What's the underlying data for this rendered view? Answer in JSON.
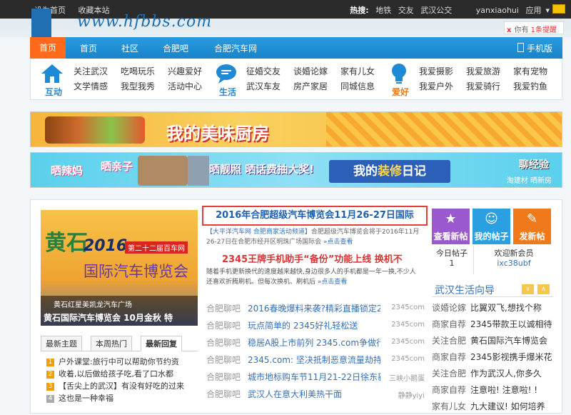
{
  "topbar": {
    "left": [
      "设为首页",
      "收藏本站"
    ],
    "hot_label": "热搜:",
    "hot": [
      "地铁",
      "交友",
      "武汉公交"
    ],
    "username": "yanxiaohui",
    "apps": "应用"
  },
  "site": {
    "url": "www.hfbbs.com"
  },
  "notify": {
    "close": "x",
    "text": "你有",
    "link": "1条提醒"
  },
  "nav": {
    "items": [
      "首页",
      "首页",
      "社区",
      "合肥吧",
      "合肥汽车网"
    ],
    "mobile": "手机版"
  },
  "subnav": {
    "groups": [
      {
        "label": "互动",
        "icon": "house-icon",
        "col1": [
          "关注武汉",
          "文学情感"
        ],
        "col2": [
          "吃喝玩乐",
          "我型我秀"
        ],
        "col3": [
          "兴趣爱好",
          "活动中心"
        ]
      },
      {
        "label": "生活",
        "icon": "chat-icon",
        "col1": [
          "征婚交友",
          "武汉车友"
        ],
        "col2": [
          "谈婚论嫁",
          "房产家居"
        ],
        "col3": [
          "家有儿女",
          "同城信息"
        ]
      },
      {
        "label": "爱好",
        "icon": "lightbulb-icon",
        "col1": [
          "我爱摄影",
          "我爱户外"
        ],
        "col2": [
          "我爱旅游",
          "我爱骑行"
        ],
        "col3": [
          "家有宠物",
          "我爱钓鱼"
        ]
      }
    ]
  },
  "banners": {
    "kitchen": {
      "title": "我的美味厨房"
    },
    "deco": {
      "a": "晒辣妈",
      "b": "晒亲子",
      "c": "晒靓照 晒话费抽大奖!",
      "d_prefix": "我的",
      "d_em": "装修",
      "d_suffix": "日记",
      "e": "聊经验",
      "f": "淘建材 晒新房"
    }
  },
  "slide": {
    "big": "黄石",
    "year": "2016",
    "tag": "第二十二届百车网",
    "expo": "国际汽车博览会",
    "small": "黄石红星美凯龙汽车广场",
    "caption": "黄石国际汽车博览会 10月金秋 特"
  },
  "tabs": [
    "最新主题",
    "本周热门",
    "最新回复"
  ],
  "hot": [
    {
      "n": "1",
      "text": "户外课堂:旅行中可以帮助你节约资"
    },
    {
      "n": "2",
      "text": "收着,以后做给孩子吃,看了口水都"
    },
    {
      "n": "3",
      "text": "【舌尖上的武汉】有没有好吃的过来"
    },
    {
      "n": "4",
      "text": "这也是一种幸福"
    }
  ],
  "headline": "2016年合肥超级汽车博览会11月26-27日国际",
  "news1": {
    "pre": "【大平洋汽车网 合肥商家活动频道】",
    "body": "合肥超级汽车博览会将于2016年11月26-27日在合肥市经开区明珠广场国际会",
    "more": "»点击查看"
  },
  "h2": "2345王牌手机助手“备份”功能上线 换机不",
  "news2": {
    "body": "随着手机更新换代的速度越来越快,身边很多人的手机都是一年一换,不少人还喜欢折腾刷机。但每次换机、刷机后",
    "more": "»点击查看"
  },
  "list": [
    {
      "cat": "合肥聊吧",
      "txt": "2016春晚爆料来袭?精彩直播锁定2345",
      "src": "2345com"
    },
    {
      "cat": "合肥聊吧",
      "txt": "玩点简单的 2345好礼轻松送",
      "src": "2345com"
    },
    {
      "cat": "合肥聊吧",
      "txt": "稳居A股上市前列 2345.com争做行业",
      "src": "2345com"
    },
    {
      "cat": "合肥聊吧",
      "txt": "2345.com: 坚决抵制恶意流量劫持",
      "src": "2345com"
    },
    {
      "cat": "合肥聊吧",
      "txt": "城市地标购车节11月21-22日徐东新",
      "src": "三峡小鹅蛋"
    },
    {
      "cat": "合肥聊吧",
      "txt": "武汉人在意大利美热干面",
      "src": "静静yiyi"
    }
  ],
  "side": {
    "btns": [
      {
        "label": "查看新帖",
        "icon": "★",
        "color": "#9b59d0"
      },
      {
        "label": "我的帖子",
        "icon": "☺",
        "color": "#2aa0e0"
      },
      {
        "label": "发新帖",
        "icon": "✎",
        "color": "#f07a1a"
      }
    ],
    "today_label": "今日帖子",
    "today": "1",
    "welcome_label": "欢迎新会员",
    "welcome": "ixc38ubf",
    "guide": "武汉生活向导",
    "guide_prev": "∨",
    "guide_next": "∧",
    "items": [
      {
        "c": "谈婚论嫁",
        "t": "比翼双飞,想找个称"
      },
      {
        "c": "商家自荐",
        "t": "2345带款王以诚相待"
      },
      {
        "c": "关注合肥",
        "t": "黄石国际汽车博览会"
      },
      {
        "c": "商家自荐",
        "t": "2345影视携手爆米花"
      },
      {
        "c": "关注合肥",
        "t": "作为武汉人,你多久"
      },
      {
        "c": "商家自荐",
        "t": "注意啦! 注意啦! !"
      },
      {
        "c": "家有儿女",
        "t": "九大建议! 如何培养"
      }
    ]
  }
}
